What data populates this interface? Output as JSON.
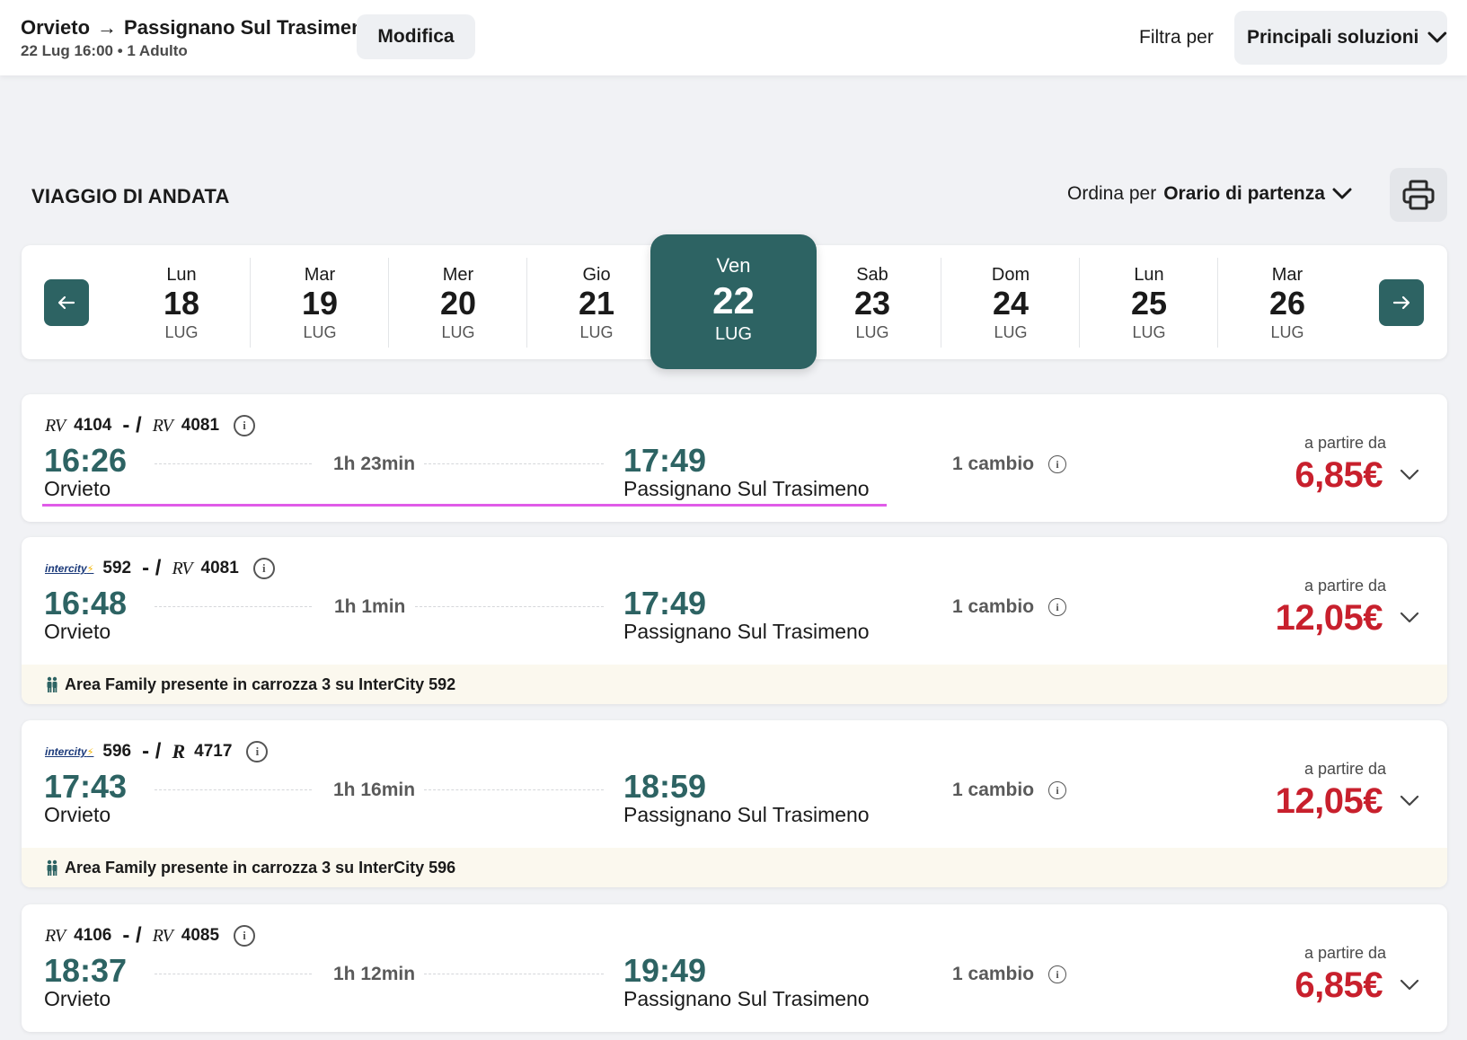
{
  "header": {
    "origin": "Orvieto",
    "destination": "Passignano Sul Trasimeno",
    "arrow": "→",
    "subtitle": "22 Lug 16:00 • 1 Adulto",
    "modify_label": "Modifica",
    "filter_label": "Filtra per",
    "filter_value": "Principali soluzioni"
  },
  "section": {
    "title": "VIAGGIO DI ANDATA",
    "sort_label": "Ordina per",
    "sort_value": "Orario di partenza"
  },
  "dates": [
    {
      "dow": "Lun",
      "num": "18",
      "mon": "LUG"
    },
    {
      "dow": "Mar",
      "num": "19",
      "mon": "LUG"
    },
    {
      "dow": "Mer",
      "num": "20",
      "mon": "LUG"
    },
    {
      "dow": "Gio",
      "num": "21",
      "mon": "LUG"
    },
    {
      "dow": "Ven",
      "num": "22",
      "mon": "LUG"
    },
    {
      "dow": "Sab",
      "num": "23",
      "mon": "LUG"
    },
    {
      "dow": "Dom",
      "num": "24",
      "mon": "LUG"
    },
    {
      "dow": "Lun",
      "num": "25",
      "mon": "LUG"
    },
    {
      "dow": "Mar",
      "num": "26",
      "mon": "LUG"
    }
  ],
  "selected_date_index": 4,
  "solutions": [
    {
      "train1_logo": "RV",
      "train1_number": "4104",
      "train2_logo": "RV",
      "train2_number": "4081",
      "separator": "- /",
      "departure_time": "16:26",
      "departure_station": "Orvieto",
      "duration": "1h 23min",
      "arrival_time": "17:49",
      "arrival_station": "Passignano Sul Trasimeno",
      "changes": "1 cambio",
      "from_label": "a partire da",
      "price": "6,85€"
    },
    {
      "train1_logo": "intercity",
      "train1_number": "592",
      "train2_logo": "RV",
      "train2_number": "4081",
      "separator": "- /",
      "departure_time": "16:48",
      "departure_station": "Orvieto",
      "duration": "1h 1min",
      "arrival_time": "17:49",
      "arrival_station": "Passignano Sul Trasimeno",
      "changes": "1 cambio",
      "from_label": "a partire da",
      "price": "12,05€",
      "notice": "Area Family presente in carrozza 3 su InterCity 592"
    },
    {
      "train1_logo": "intercity",
      "train1_number": "596",
      "train2_logo": "R",
      "train2_number": "4717",
      "separator": "- /",
      "departure_time": "17:43",
      "departure_station": "Orvieto",
      "duration": "1h 16min",
      "arrival_time": "18:59",
      "arrival_station": "Passignano Sul Trasimeno",
      "changes": "1 cambio",
      "from_label": "a partire da",
      "price": "12,05€",
      "notice": "Area Family presente in carrozza 3 su InterCity 596"
    },
    {
      "train1_logo": "RV",
      "train1_number": "4106",
      "train2_logo": "RV",
      "train2_number": "4085",
      "separator": "- /",
      "departure_time": "18:37",
      "departure_station": "Orvieto",
      "duration": "1h 12min",
      "arrival_time": "19:49",
      "arrival_station": "Passignano Sul Trasimeno",
      "changes": "1 cambio",
      "from_label": "a partire da",
      "price": "6,85€"
    }
  ],
  "icons": {
    "prev": "arrow-left-icon",
    "next": "arrow-right-icon",
    "print": "printer-icon",
    "info": "info-icon",
    "expand": "chevron-down-icon",
    "family": "family-icon"
  },
  "colors": {
    "primary": "#2d6363",
    "price": "#c8202d",
    "notice_bg": "#fbf8ee",
    "selection": "#e05ce8"
  }
}
